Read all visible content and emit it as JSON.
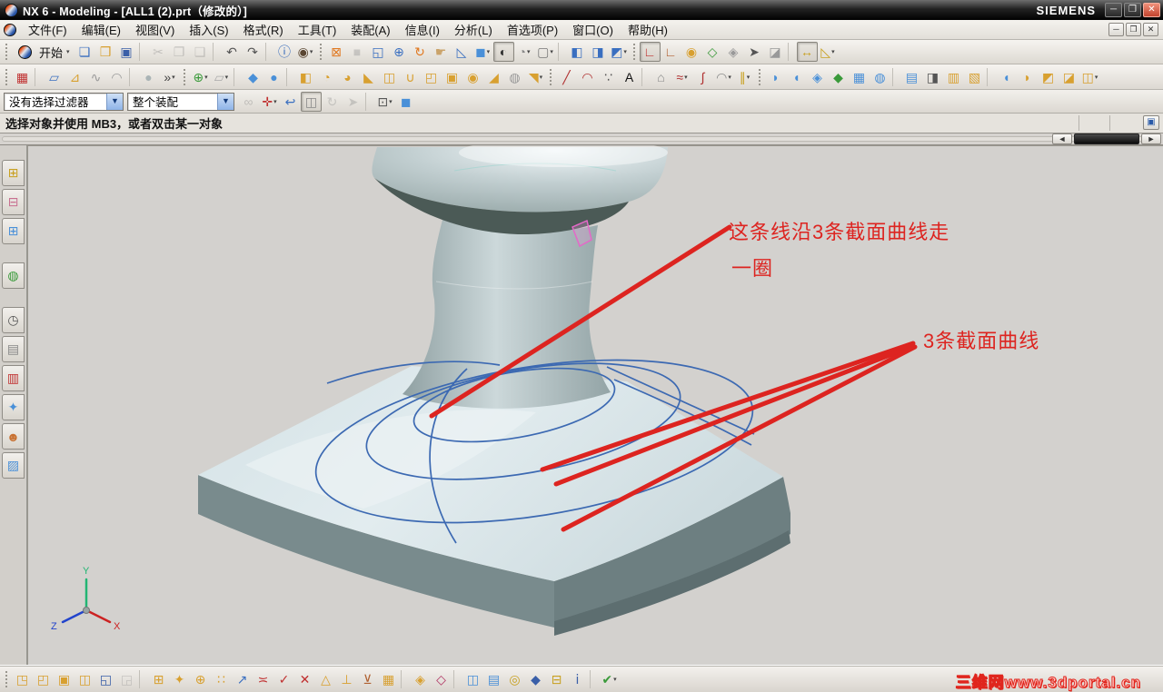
{
  "title_bar": {
    "title": "NX 6 - Modeling - [ALL1 (2).prt（修改的）]",
    "brand": "SIEMENS",
    "window_buttons": [
      {
        "name": "minimize-button",
        "glyph": "─",
        "color": "#eeeeee"
      },
      {
        "name": "restore-button",
        "glyph": "❐",
        "color": "#eeeeee"
      },
      {
        "name": "close-button",
        "glyph": "✕",
        "color": "#ffffff",
        "accent": true
      }
    ]
  },
  "menu_bar": {
    "items": [
      {
        "name": "menu-file",
        "label": "文件(F)"
      },
      {
        "name": "menu-edit",
        "label": "编辑(E)"
      },
      {
        "name": "menu-view",
        "label": "视图(V)"
      },
      {
        "name": "menu-insert",
        "label": "插入(S)"
      },
      {
        "name": "menu-format",
        "label": "格式(R)"
      },
      {
        "name": "menu-tools",
        "label": "工具(T)"
      },
      {
        "name": "menu-assemblies",
        "label": "装配(A)"
      },
      {
        "name": "menu-information",
        "label": "信息(I)"
      },
      {
        "name": "menu-analysis",
        "label": "分析(L)"
      },
      {
        "name": "menu-preferences",
        "label": "首选项(P)"
      },
      {
        "name": "menu-window",
        "label": "窗口(O)"
      },
      {
        "name": "menu-help",
        "label": "帮助(H)"
      }
    ],
    "mdi_buttons": [
      {
        "name": "child-minimize-button",
        "glyph": "─",
        "color": "#333333"
      },
      {
        "name": "child-restore-button",
        "glyph": "❐",
        "color": "#333333"
      },
      {
        "name": "child-close-button",
        "glyph": "✕",
        "color": "#333333"
      }
    ]
  },
  "toolbar_main": {
    "start_label": "开始",
    "items": [
      {
        "name": "new-part",
        "glyph": "❏",
        "color": "#3a6fc0"
      },
      {
        "name": "open-part",
        "glyph": "❒",
        "color": "#d8a030"
      },
      {
        "name": "save-part",
        "glyph": "▣",
        "color": "#3a5fa8"
      },
      {
        "sep": true
      },
      {
        "name": "cut",
        "glyph": "✂",
        "color": "#777777",
        "disabled": true
      },
      {
        "name": "copy",
        "glyph": "❐",
        "color": "#777777",
        "disabled": true
      },
      {
        "name": "paste",
        "glyph": "❑",
        "color": "#777777",
        "disabled": true
      },
      {
        "sep": true
      },
      {
        "name": "undo",
        "glyph": "↶",
        "color": "#555555"
      },
      {
        "name": "redo",
        "glyph": "↷",
        "color": "#555555"
      },
      {
        "sep": true
      },
      {
        "name": "part-information",
        "glyph": "ⓘ",
        "color": "#2a62b8"
      },
      {
        "name": "find-component-search",
        "glyph": "◉",
        "color": "#5a4632",
        "dropdown": true
      },
      {
        "grip": true
      },
      {
        "name": "fit-view",
        "glyph": "⊠",
        "color": "#e07820"
      },
      {
        "name": "zoom-view",
        "glyph": "■",
        "color": "#888888",
        "disabled": true
      },
      {
        "name": "zoom-region",
        "glyph": "◱",
        "color": "#3a6fc0"
      },
      {
        "name": "zoom-in-out",
        "glyph": "⊕",
        "color": "#3a6fc0"
      },
      {
        "name": "rotate-view",
        "glyph": "↻",
        "color": "#e07820"
      },
      {
        "name": "pan-view",
        "glyph": "☛",
        "color": "#caa36a"
      },
      {
        "name": "perspective-view",
        "glyph": "◺",
        "color": "#3a6fc0"
      },
      {
        "name": "shaded-with-edges",
        "glyph": "◼",
        "color": "#4a90d8",
        "dropdown": true
      },
      {
        "name": "face-analysis",
        "glyph": "◐",
        "color": "#333333",
        "boxed": true
      },
      {
        "name": "rendering-style",
        "glyph": "◔",
        "color": "#8a8a8a",
        "dropdown": true
      },
      {
        "name": "view-background",
        "glyph": "▢",
        "color": "#777777",
        "dropdown": true
      },
      {
        "sep": true
      },
      {
        "name": "new-window",
        "glyph": "◧",
        "color": "#3a6fc0"
      },
      {
        "name": "window-cascade",
        "glyph": "◨",
        "color": "#3a6fc0"
      },
      {
        "name": "window-layout",
        "glyph": "◩",
        "color": "#3a6fc0",
        "dropdown": true
      },
      {
        "grip": true
      },
      {
        "name": "csys-dynamics",
        "glyph": "∟",
        "color": "#c03030",
        "boxed": true
      },
      {
        "name": "wcs-orient",
        "glyph": "∟",
        "color": "#b06030"
      },
      {
        "name": "wcs-origin",
        "glyph": "◉",
        "color": "#d8a030"
      },
      {
        "name": "set-rotation-point",
        "glyph": "◇",
        "color": "#3a9a3a"
      },
      {
        "name": "clear-rotation-reference",
        "glyph": "◈",
        "color": "#999999"
      },
      {
        "name": "select-tool",
        "glyph": "➤",
        "color": "#555555"
      },
      {
        "name": "deselect-all",
        "glyph": "◪",
        "color": "#999999"
      },
      {
        "sep": true
      },
      {
        "name": "measure-distance",
        "glyph": "↔",
        "color": "#c8a020",
        "boxed": true
      },
      {
        "name": "measure-angle",
        "glyph": "◺",
        "color": "#c8a020",
        "dropdown": true
      }
    ]
  },
  "toolbar_feature": {
    "items": [
      {
        "name": "sketch",
        "glyph": "▦",
        "color": "#c03030"
      },
      {
        "sep": true
      },
      {
        "name": "datum-plane",
        "glyph": "▱",
        "color": "#3a6fc0"
      },
      {
        "name": "datum-csys",
        "glyph": "⊿",
        "color": "#d8a030"
      },
      {
        "name": "swept-feature",
        "glyph": "∿",
        "color": "#999999"
      },
      {
        "name": "tube-feature",
        "glyph": "◠",
        "color": "#999999"
      },
      {
        "sep": true
      },
      {
        "name": "sphere-feature",
        "glyph": "●",
        "color": "#aab4b6"
      },
      {
        "name": "more-features",
        "glyph": "»",
        "color": "#444444",
        "dropdown": true
      },
      {
        "grip": true
      },
      {
        "name": "point-set",
        "glyph": "⊕",
        "color": "#3a9a3a",
        "dropdown": true
      },
      {
        "name": "plane",
        "glyph": "▱",
        "color": "#aaaaaa",
        "dropdown": true
      },
      {
        "sep": true
      },
      {
        "name": "revolve-body",
        "glyph": "◆",
        "color": "#4a90d8"
      },
      {
        "name": "sphere-body",
        "glyph": "●",
        "color": "#4a90d8"
      },
      {
        "sep": true
      },
      {
        "name": "extrude",
        "glyph": "◧",
        "color": "#d8a030"
      },
      {
        "name": "revolve",
        "glyph": "◔",
        "color": "#d8a030"
      },
      {
        "name": "sweep-along-guide",
        "glyph": "◕",
        "color": "#d8a030"
      },
      {
        "name": "rib",
        "glyph": "◣",
        "color": "#d8a030"
      },
      {
        "name": "emboss",
        "glyph": "◫",
        "color": "#d8a030"
      },
      {
        "name": "unite",
        "glyph": "∪",
        "color": "#d8a030"
      },
      {
        "name": "trim-body",
        "glyph": "◰",
        "color": "#d8a030"
      },
      {
        "name": "shell",
        "glyph": "▣",
        "color": "#d8a030"
      },
      {
        "name": "edge-blend",
        "glyph": "◉",
        "color": "#d8a030"
      },
      {
        "name": "chamfer",
        "glyph": "◢",
        "color": "#d8a030"
      },
      {
        "name": "thread",
        "glyph": "◍",
        "color": "#999999"
      },
      {
        "name": "draft",
        "glyph": "◥",
        "color": "#d8a030",
        "dropdown": true
      },
      {
        "grip": true
      },
      {
        "name": "line",
        "glyph": "╱",
        "color": "#b03030"
      },
      {
        "name": "arc",
        "glyph": "◠",
        "color": "#b03030"
      },
      {
        "name": "point",
        "glyph": "∵",
        "color": "#555555"
      },
      {
        "name": "text-curve",
        "glyph": "A",
        "color": "#111111"
      },
      {
        "sep": true
      },
      {
        "name": "profile",
        "glyph": "⌂",
        "color": "#888888"
      },
      {
        "name": "spline",
        "glyph": "≈",
        "color": "#b03030",
        "dropdown": true
      },
      {
        "name": "studio-spline",
        "glyph": "∫",
        "color": "#b03030"
      },
      {
        "name": "curve-on-surface",
        "glyph": "◠",
        "color": "#888888",
        "dropdown": true
      },
      {
        "name": "offset-curve",
        "glyph": "∥",
        "color": "#c8a020",
        "dropdown": true
      },
      {
        "grip": true
      },
      {
        "name": "through-curves",
        "glyph": "◗",
        "color": "#4a90d8"
      },
      {
        "name": "through-curve-mesh",
        "glyph": "◖",
        "color": "#4a90d8"
      },
      {
        "name": "swept-surface",
        "glyph": "◈",
        "color": "#4a90d8"
      },
      {
        "name": "surface-wizard",
        "glyph": "◆",
        "color": "#3a9a3a"
      },
      {
        "name": "studio-surface",
        "glyph": "▦",
        "color": "#4a90d8"
      },
      {
        "name": "bounded-plane",
        "glyph": "◍",
        "color": "#4a90d8"
      },
      {
        "sep": true
      },
      {
        "name": "ruled-surface",
        "glyph": "▤",
        "color": "#4a90d8"
      },
      {
        "name": "transition-surface",
        "glyph": "◨",
        "color": "#555555"
      },
      {
        "name": "section-surface",
        "glyph": "▥",
        "color": "#d8a030"
      },
      {
        "name": "bridge-surface",
        "glyph": "▧",
        "color": "#d8a030"
      },
      {
        "sep": true
      },
      {
        "name": "law-extension",
        "glyph": "◖",
        "color": "#4a90d8"
      },
      {
        "name": "offset-surface",
        "glyph": "◗",
        "color": "#d8a030"
      },
      {
        "name": "trimmed-sheet",
        "glyph": "◩",
        "color": "#d8a030"
      },
      {
        "name": "extension-surface",
        "glyph": "◪",
        "color": "#d8a030"
      },
      {
        "name": "sew",
        "glyph": "◫",
        "color": "#d8a030",
        "dropdown": true
      }
    ]
  },
  "selection_bar": {
    "filter_value": "没有选择过滤器",
    "scope_value": "整个装配",
    "items": [
      {
        "name": "interpart-selection",
        "glyph": "∞",
        "color": "#777777",
        "disabled": true
      },
      {
        "name": "snap-point",
        "glyph": "✛",
        "color": "#c03030",
        "dropdown": true
      },
      {
        "name": "undo-selection",
        "glyph": "↩",
        "color": "#3a6fc0"
      },
      {
        "name": "highlight-shaded",
        "glyph": "◫",
        "color": "#888888",
        "boxed": true
      },
      {
        "name": "rotate-disabled",
        "glyph": "↻",
        "color": "#888888",
        "disabled": true
      },
      {
        "name": "move-disabled",
        "glyph": "➤",
        "color": "#888888",
        "disabled": true
      },
      {
        "sep": true
      },
      {
        "name": "rectangle-select",
        "glyph": "⊡",
        "color": "#555555",
        "dropdown": true
      },
      {
        "name": "work-view",
        "glyph": "◼",
        "color": "#4a90d8"
      }
    ]
  },
  "prompt_bar": {
    "message": "选择对象并使用 MB3，或者双击某一对象",
    "corner_button_glyph": "▣"
  },
  "hscrollbar": {
    "left_arrow": "◄",
    "right_arrow": "►"
  },
  "resource_bar": {
    "tabs": [
      {
        "name": "assembly-navigator-tab",
        "glyph": "⊞",
        "color": "#c8a020"
      },
      {
        "name": "constraint-navigator-tab",
        "glyph": "⊟",
        "color": "#c87090"
      },
      {
        "name": "part-navigator-tab",
        "glyph": "⊞",
        "color": "#4a90d8"
      },
      {
        "gap": true
      },
      {
        "name": "web-browser-tab",
        "glyph": "◍",
        "color": "#3a9a3a"
      },
      {
        "gap": true
      },
      {
        "name": "history-tab",
        "glyph": "◷",
        "color": "#555555"
      },
      {
        "name": "system-scenes-tab",
        "glyph": "▤",
        "color": "#888888"
      },
      {
        "name": "visualization-palette-tab",
        "glyph": "▥",
        "color": "#c03030"
      },
      {
        "name": "materials-tab",
        "glyph": "✦",
        "color": "#4a90d8"
      },
      {
        "name": "roles-tab",
        "glyph": "☻",
        "color": "#c87030"
      },
      {
        "name": "image-gallery-tab",
        "glyph": "▨",
        "color": "#4a90d8"
      }
    ]
  },
  "viewport": {
    "annotation_line1": "这条线沿3条截面曲线走",
    "annotation_line2": "一圈",
    "annotation_section": "3条截面曲线",
    "annotation_color": "#dd2420",
    "curve_color": "#3c69b2",
    "triad": {
      "x_label": "X",
      "y_label": "Y",
      "z_label": "Z",
      "x_color": "#cc2222",
      "y_color": "#22b573",
      "z_color": "#2244cc"
    }
  },
  "toolbar_assembly": {
    "items": [
      {
        "name": "find-component",
        "glyph": "◳",
        "color": "#d8a030"
      },
      {
        "name": "open-by-proximity",
        "glyph": "◰",
        "color": "#d8a030"
      },
      {
        "name": "show-product-outline",
        "glyph": "▣",
        "color": "#d8a030"
      },
      {
        "name": "open-component",
        "glyph": "◫",
        "color": "#d8a030"
      },
      {
        "name": "save-component",
        "glyph": "◱",
        "color": "#3a5fa8"
      },
      {
        "name": "close-component",
        "glyph": "◲",
        "color": "#888888",
        "disabled": true
      },
      {
        "sep": true
      },
      {
        "name": "add-component",
        "glyph": "⊞",
        "color": "#d8a030"
      },
      {
        "name": "new-component",
        "glyph": "✦",
        "color": "#d8a030"
      },
      {
        "name": "new-parent",
        "glyph": "⊕",
        "color": "#d8a030"
      },
      {
        "name": "create-component-array",
        "glyph": "∷",
        "color": "#d8a030"
      },
      {
        "name": "substitute-component",
        "glyph": "↗",
        "color": "#3a6fc0"
      },
      {
        "name": "mirror-assembly",
        "glyph": "≍",
        "color": "#c03030"
      },
      {
        "name": "suppress-component",
        "glyph": "✓",
        "color": "#c03030"
      },
      {
        "name": "edit-suppression-state",
        "glyph": "✕",
        "color": "#c03030"
      },
      {
        "name": "move-component",
        "glyph": "△",
        "color": "#d8a030"
      },
      {
        "name": "assembly-constraints",
        "glyph": "⊥",
        "color": "#d8a030"
      },
      {
        "name": "show-degrees-of-freedom",
        "glyph": "⊻",
        "color": "#b06030"
      },
      {
        "name": "remember-constraints",
        "glyph": "▦",
        "color": "#d8a030"
      },
      {
        "sep": true
      },
      {
        "name": "wave-geometry-linker",
        "glyph": "◈",
        "color": "#d8a030"
      },
      {
        "name": "wave-mode",
        "glyph": "◇",
        "color": "#b03060"
      },
      {
        "sep": true
      },
      {
        "name": "exploded-views",
        "glyph": "◫",
        "color": "#4a90d8"
      },
      {
        "name": "assembly-sequence",
        "glyph": "▤",
        "color": "#4a90d8"
      },
      {
        "name": "clearance-analysis",
        "glyph": "◎",
        "color": "#c8a020"
      },
      {
        "name": "interference-check",
        "glyph": "◆",
        "color": "#3a5fa8"
      },
      {
        "name": "component-attributes",
        "glyph": "⊟",
        "color": "#c8a020"
      },
      {
        "name": "component-information",
        "glyph": "ⅰ",
        "color": "#3a5fa8"
      },
      {
        "sep": true
      },
      {
        "name": "check-mate",
        "glyph": "✔",
        "color": "#3a9a3a",
        "dropdown": true
      }
    ]
  },
  "watermark": {
    "text": "三维网www.3dportal.cn"
  }
}
